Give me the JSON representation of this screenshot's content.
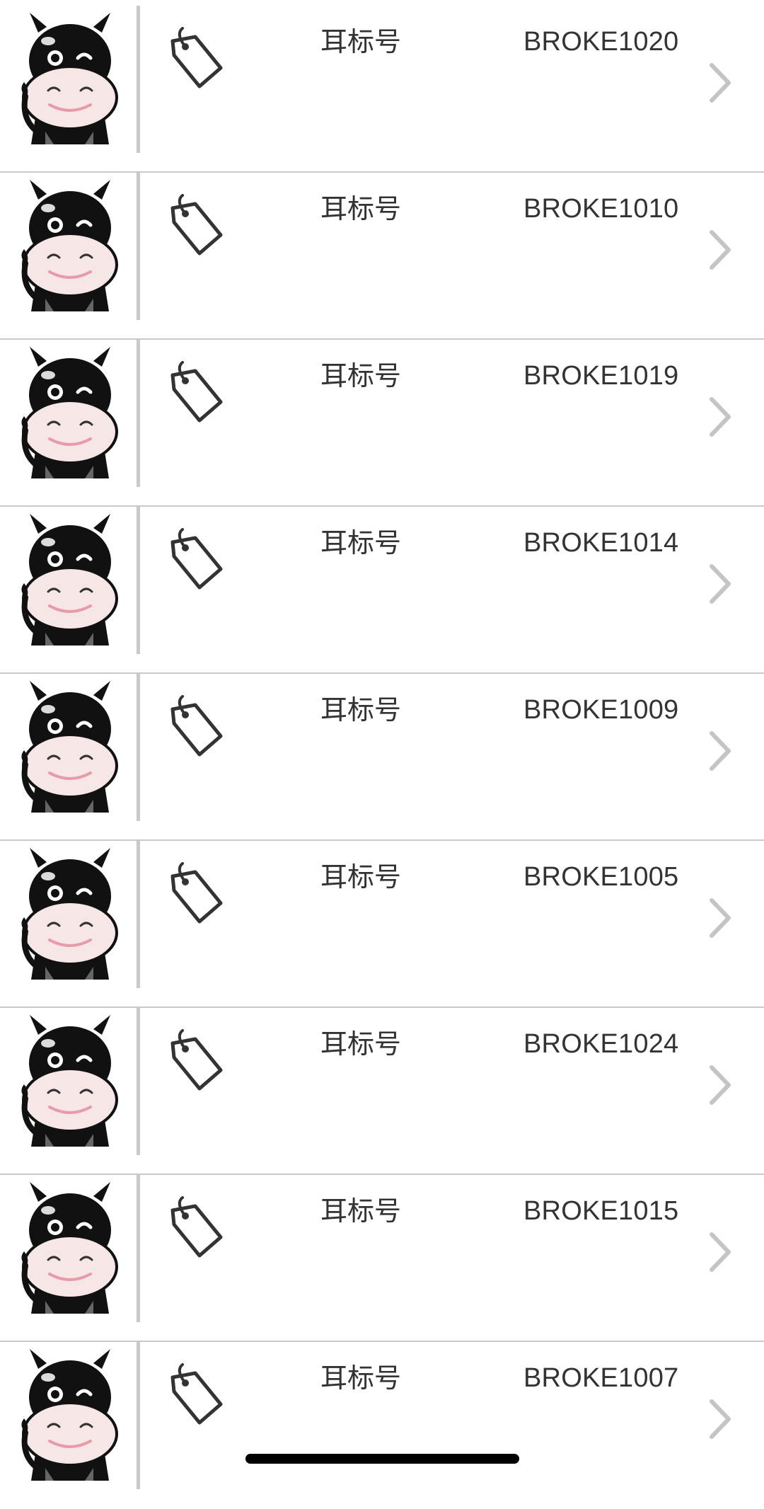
{
  "list": {
    "items": [
      {
        "label": "耳标号",
        "value": "BROKE1020"
      },
      {
        "label": "耳标号",
        "value": "BROKE1010"
      },
      {
        "label": "耳标号",
        "value": "BROKE1019"
      },
      {
        "label": "耳标号",
        "value": "BROKE1014"
      },
      {
        "label": "耳标号",
        "value": "BROKE1009"
      },
      {
        "label": "耳标号",
        "value": "BROKE1005"
      },
      {
        "label": "耳标号",
        "value": "BROKE1024"
      },
      {
        "label": "耳标号",
        "value": "BROKE1015"
      },
      {
        "label": "耳标号",
        "value": "BROKE1007"
      }
    ]
  },
  "icons": {
    "avatar": "cow-avatar-icon",
    "tag": "tag-icon",
    "chevron": "chevron-right-icon"
  },
  "colors": {
    "background": "#ffffff",
    "divider": "#c8c8c8",
    "text": "#333333",
    "chevron": "#c4c4c4",
    "cow_black": "#111111",
    "cow_face": "#f6e6e6"
  }
}
